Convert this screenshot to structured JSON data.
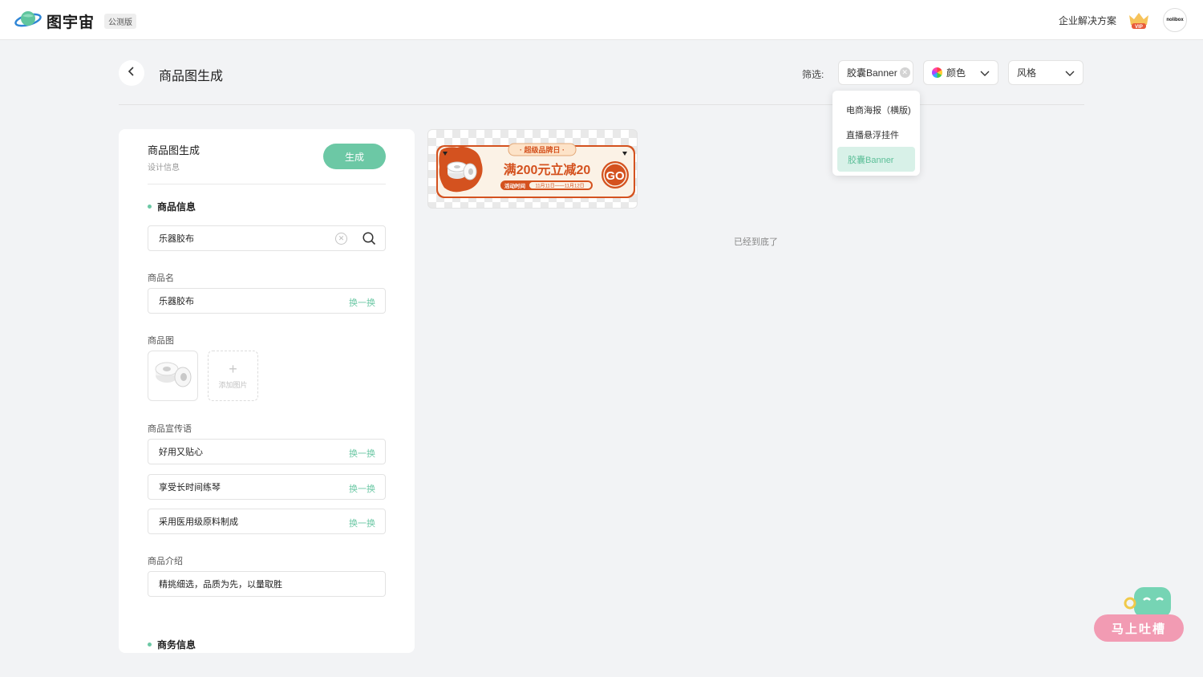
{
  "app": {
    "name": "图宇宙",
    "beta_badge": "公测版"
  },
  "nav": {
    "enterprise": "企业解决方案",
    "vip": "VIP",
    "avatar_text": "nolibox"
  },
  "header": {
    "title": "商品图生成",
    "filter_label": "筛选:",
    "filters": {
      "type": "胶囊Banner",
      "color": "颜色",
      "style": "风格"
    }
  },
  "dropdown": {
    "items": [
      "电商海报（横版)",
      "直播悬浮挂件",
      "胶囊Banner"
    ],
    "selected": "胶囊Banner"
  },
  "panel": {
    "title": "商品图生成",
    "subtitle": "设计信息",
    "generate": "生成",
    "section_product": "商品信息",
    "search_value": "乐器胶布",
    "name_label": "商品名",
    "name_value": "乐器胶布",
    "swap": "换一换",
    "image_label": "商品图",
    "add_image": "添加图片",
    "slogan_label": "商品宣传语",
    "slogans": [
      "好用又贴心",
      "享受长时间练琴",
      "采用医用级原料制成"
    ],
    "intro_label": "商品介绍",
    "intro_value": "精挑细选，品质为先，以量取胜",
    "section_business": "商务信息"
  },
  "banner": {
    "tag": "· 超级品牌日 ·",
    "headline": "满200元立减20",
    "time_label": "活动时间",
    "time_range": "11月11日——11月12日",
    "cta": "GO",
    "colors": {
      "accent": "#d4521f",
      "cream": "#fbf2e6",
      "tag_bg": "#fde3c8"
    }
  },
  "end_text": "已经到底了",
  "feedback": "马上吐槽",
  "colors": {
    "primary": "#6cc8a5",
    "feedback": "#f29bb3"
  }
}
